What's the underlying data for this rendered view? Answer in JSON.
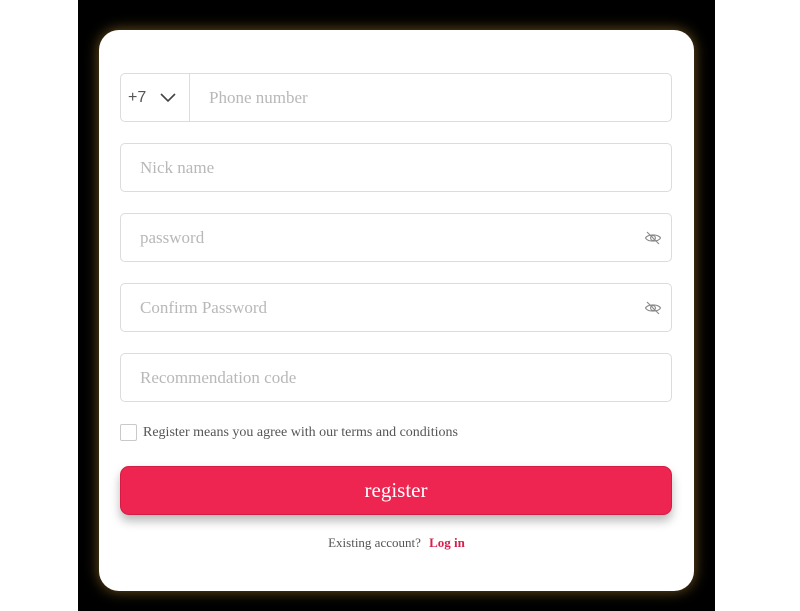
{
  "form": {
    "phone": {
      "country_code": "+7",
      "placeholder": "Phone number",
      "value": ""
    },
    "nickname": {
      "placeholder": "Nick name",
      "value": ""
    },
    "password": {
      "placeholder": "password",
      "value": ""
    },
    "confirm_password": {
      "placeholder": "Confirm Password",
      "value": ""
    },
    "recommendation_code": {
      "placeholder": "Recommendation code",
      "value": ""
    },
    "agree": {
      "label": "Register means you agree with our terms and conditions",
      "checked": false
    },
    "register_label": "register",
    "existing_account_text": "Existing account?",
    "login_label": "Log in"
  },
  "icons": {
    "country_dropdown": "chevron-down-icon",
    "password_toggle": "eye-off-icon",
    "confirm_password_toggle": "eye-off-icon"
  },
  "colors": {
    "backdrop": "#000000",
    "card": "#ffffff",
    "accent": "#ee2550",
    "link": "#d6204a",
    "border": "#dcdcdc",
    "placeholder": "#b8b8b8"
  }
}
